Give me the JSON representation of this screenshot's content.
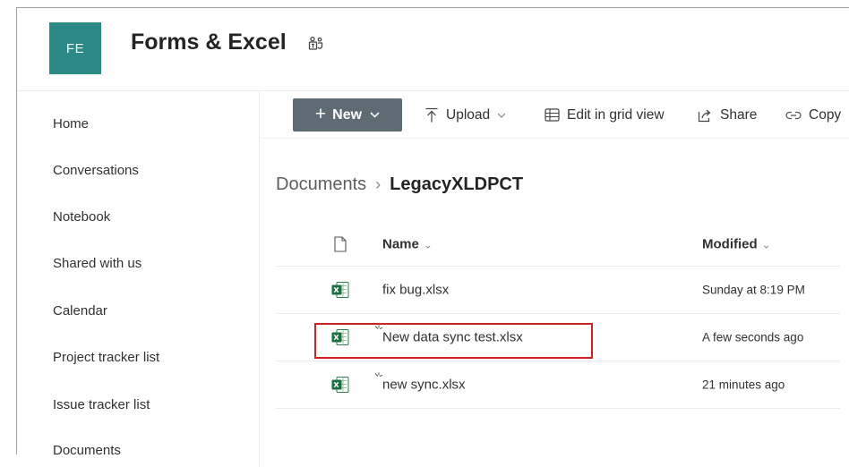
{
  "site": {
    "logo_initials": "FE",
    "logo_color": "#2b8a86",
    "title": "Forms & Excel",
    "teams_icon": "teams-icon"
  },
  "nav": {
    "items": [
      {
        "label": "Home"
      },
      {
        "label": "Conversations"
      },
      {
        "label": "Notebook"
      },
      {
        "label": "Shared with us"
      },
      {
        "label": "Calendar"
      },
      {
        "label": "Project tracker list"
      },
      {
        "label": "Issue tracker list"
      },
      {
        "label": "Documents"
      }
    ]
  },
  "commands": {
    "new_label": "New",
    "upload_label": "Upload",
    "grid_label": "Edit in grid view",
    "share_label": "Share",
    "copy_label": "Copy"
  },
  "breadcrumb": {
    "parent": "Documents",
    "current": "LegacyXLDPCT"
  },
  "list": {
    "columns": {
      "name": "Name",
      "modified": "Modified"
    },
    "files": [
      {
        "name": "fix bug.xlsx",
        "modified": "Sunday at 8:19 PM",
        "is_new": false
      },
      {
        "name": "New data sync test.xlsx",
        "modified": "A few seconds ago",
        "is_new": true,
        "highlighted": true
      },
      {
        "name": "new sync.xlsx",
        "modified": "21 minutes ago",
        "is_new": true
      }
    ]
  },
  "colors": {
    "accent": "#5f6b73",
    "highlight": "#d21f1f",
    "excel_green": "#1d6f42"
  }
}
